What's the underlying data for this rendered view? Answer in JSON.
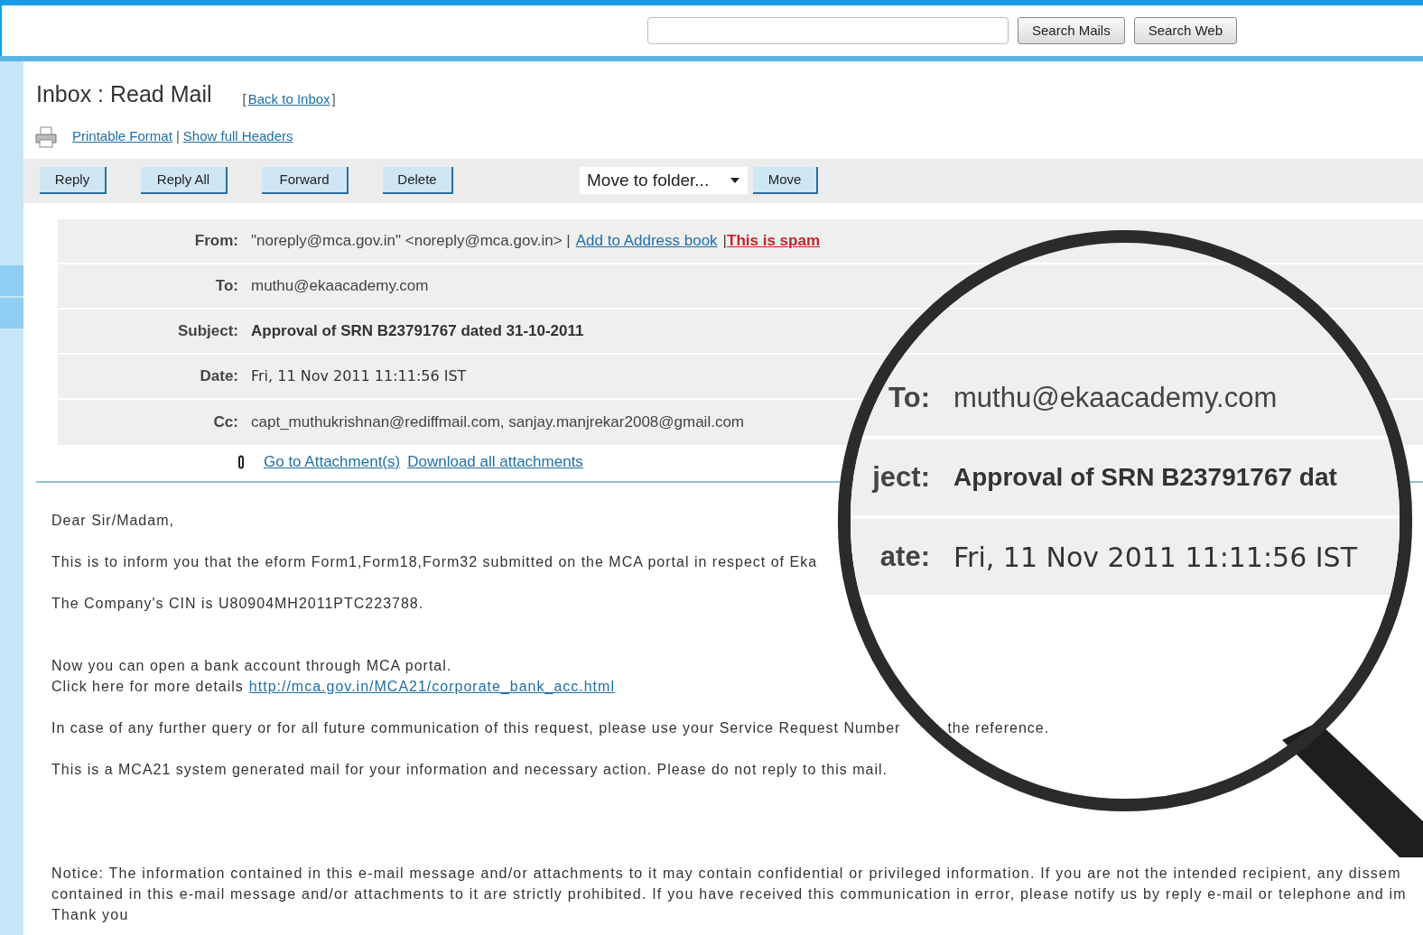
{
  "search": {
    "buttons": [
      "Search Mails",
      "Search Web"
    ]
  },
  "title": "Inbox : Read Mail",
  "back_link": {
    "open": "[",
    "label": "Back to Inbox",
    "close": "]"
  },
  "header_links": {
    "items": [
      "Printable Format",
      "Show full Headers"
    ],
    "separator": "|"
  },
  "toolbar": {
    "buttons": [
      "Reply",
      "Reply All",
      "Forward",
      "Delete"
    ],
    "folder_select": "Move to folder...",
    "move_button": "Move"
  },
  "headers": [
    {
      "label": "From:",
      "value": "\"noreply@mca.gov.in\" <noreply@mca.gov.in> |",
      "kind": "plain",
      "links": [
        {
          "text": "Add to Address book",
          "kind": "link"
        },
        {
          "text": "|",
          "kind": "plain"
        },
        {
          "text": "This is spam",
          "kind": "spam"
        }
      ]
    },
    {
      "label": "To:",
      "value": "muthu@ekaacademy.com",
      "kind": "plain"
    },
    {
      "label": "Subject:",
      "value": "Approval of SRN B23791767 dated 31-10-2011",
      "kind": "bold"
    },
    {
      "label": "Date:",
      "value": "Fri, 11 Nov 2011 11:11:56 IST",
      "kind": "date"
    },
    {
      "label": "Cc:",
      "value": "capt_muthukrishnan@rediffmail.com, sanjay.manjrekar2008@gmail.com",
      "kind": "plain"
    }
  ],
  "attachments": {
    "links": [
      "Go to Attachment(s)",
      "Download all attachments"
    ]
  },
  "body": [
    {
      "lines": [
        [
          {
            "text": "Dear Sir/Madam,",
            "kind": "text"
          }
        ]
      ]
    },
    {
      "lines": [
        [
          {
            "text": "This is to inform you that the eform Form1,Form18,Form32 submitted on the MCA portal in respect of Eka",
            "kind": "text"
          }
        ]
      ]
    },
    {
      "lines": [
        [
          {
            "text": "The Company's CIN is U80904MH2011PTC223788.",
            "kind": "text"
          }
        ]
      ]
    },
    {
      "lines": [
        [
          {
            "text": "Now you can open a bank account through MCA portal.",
            "kind": "text"
          }
        ],
        [
          {
            "text": "Click here for more details",
            "kind": "text"
          },
          {
            "text": "http://mca.gov.in/MCA21/corporate_bank_acc.html",
            "kind": "link"
          }
        ]
      ],
      "spaced": true
    },
    {
      "lines": [
        [
          {
            "text": "In case of any further query or for all future communication of this request, please use your Service Request Number",
            "kind": "text"
          },
          {
            "text": "the reference.",
            "kind": "after_gap"
          }
        ]
      ]
    },
    {
      "lines": [
        [
          {
            "text": "This is a MCA21 system generated mail for your information and necessary action. Please do not reply to this mail.",
            "kind": "text"
          }
        ]
      ]
    }
  ],
  "notice": [
    "Notice: The information contained in this e-mail message and/or attachments to it may contain confidential or privileged information. If you are not the intended recipient, any dissem",
    "contained in this e-mail message and/or attachments to it are strictly prohibited. If you have received this communication in error, please notify us by reply e-mail or telephone and im",
    "Thank you"
  ],
  "magnifier": {
    "rows": [
      {
        "label": "To:",
        "value": "muthu@ekaacademy.com",
        "kind": "plain"
      },
      {
        "label": "ject:",
        "value": "Approval of SRN B23791767 dat",
        "kind": "bold"
      },
      {
        "label": "ate:",
        "value": "Fri, 11 Nov 2011 11:11:56 IST",
        "kind": "date"
      }
    ]
  }
}
